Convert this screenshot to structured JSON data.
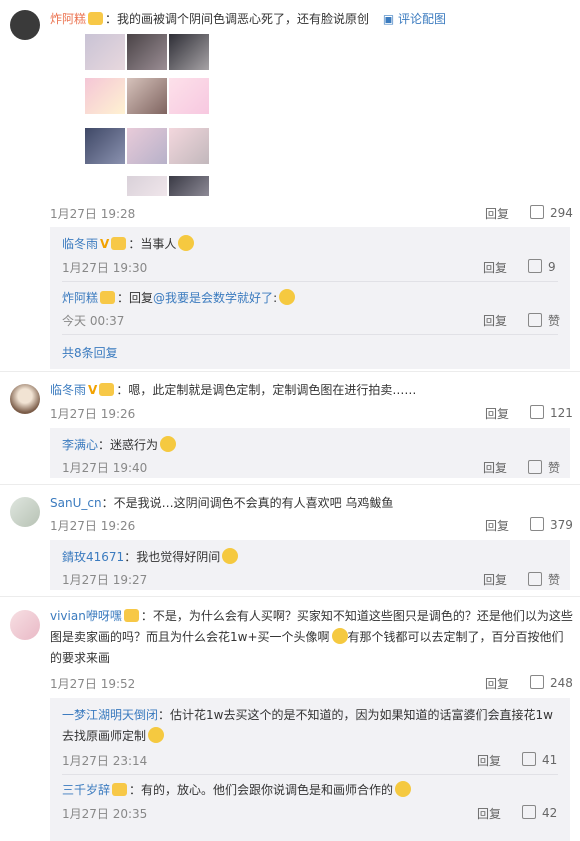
{
  "comments": [
    {
      "user": "炸阿糕",
      "text": "我的画被调个阴间色调恶心死了，还有脸说原创",
      "tag": "评论配图",
      "time": "1月27日 19:28",
      "reply": "回复",
      "likes": "294"
    },
    {
      "user": "临冬雨",
      "text": "嗯，此定制就是调色定制，定制调色图在进行拍卖……",
      "time": "1月27日 19:26",
      "reply": "回复",
      "likes": "121"
    },
    {
      "user": "SanU_cn",
      "text": "不是我说…这阴间调色不会真的有人喜欢吧 乌鸡鲅鱼",
      "time": "1月27日 19:26",
      "reply": "回复",
      "likes": "379"
    },
    {
      "user": "vivian咿呀嘿",
      "text1": "不是，为什么会有人买啊？买家知不知道这些图只是调色的？还是他们以为这些",
      "text2": "图是卖家画的吗？而且为什么会花1w+买一个头像啊",
      "text2b": "有那个钱都可以去定制了，百分百按他们",
      "text3": "的要求来画",
      "time": "1月27日 19:52",
      "reply": "回复",
      "likes": "248"
    }
  ],
  "replies": [
    {
      "user": "临冬雨",
      "text": "当事人",
      "time": "1月27日 19:30",
      "reply": "回复",
      "likes": "9"
    },
    {
      "user": "炸阿糕",
      "text": "回复",
      "mention": "@我要是会数学就好了",
      "text_end": ":",
      "time": "今天 00:37",
      "reply": "回复",
      "likes": "赞"
    },
    {
      "user": "李满心",
      "text": "迷惑行为",
      "time": "1月27日 19:40",
      "reply": "回复",
      "likes": "赞"
    },
    {
      "user": "錆玫41671",
      "text": "我也觉得好阴间",
      "time": "1月27日 19:27",
      "reply": "回复",
      "likes": "赞"
    },
    {
      "user": "一梦江湖明天倒闭",
      "text1": "估计花1w去买这个的是不知道的，因为如果知道的话富婆们会直接花1w",
      "text2": "去找原画师定制",
      "time": "1月27日 23:14",
      "reply": "回复",
      "likes": "41"
    },
    {
      "user": "三千岁辞",
      "text": "有的，放心。他们会跟你说调色是和画师合作的",
      "time": "1月27日 20:35",
      "reply": "回复",
      "likes": "42"
    }
  ],
  "more_replies": "共8条回复",
  "colors": {
    "name": "#eb7350",
    "blue": "#3b7bbf",
    "bg_reply": "#f2f2f5"
  }
}
